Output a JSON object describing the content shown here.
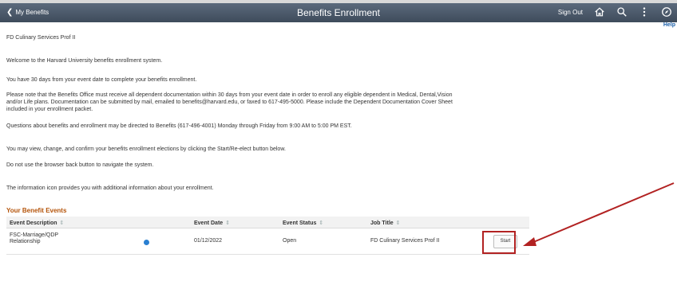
{
  "header": {
    "back_label": "My Benefits",
    "title": "Benefits Enrollment",
    "signout_label": "Sign Out",
    "help_label": "Help"
  },
  "content": {
    "job_label": "FD Culinary Services Prof II",
    "welcome": "Welcome to the Harvard University benefits enrollment system.",
    "deadline": "You have 30 days from your event date to complete your benefits enrollment.",
    "note_line1": "Please note that the Benefits Office must receive all dependent documentation within 30 days from your event date in order to enroll any eligible dependent in Medical, Dental,Vision",
    "note_line2": "and/or Life plans. Documentation can be submitted by mail, emailed to benefits@harvard.edu, or faxed to 617-495-5000. Please include the Dependent Documentation Cover Sheet",
    "note_line3": "included in your enrollment packet.",
    "questions": "Questions about benefits and enrollment may be directed to Benefits (617-496-4001) Monday through Friday from 9:00 AM to 5:00 PM EST.",
    "view_change": "You may view, change, and confirm your benefits enrollment elections by clicking the Start/Re-elect button below.",
    "no_back": "Do not use the browser back button to navigate the system.",
    "info_icon_note": "The information icon provides you with additional information about your enrollment."
  },
  "events": {
    "title": "Your Benefit Events",
    "columns": {
      "description": "Event Description",
      "date": "Event Date",
      "status": "Event Status",
      "job": "Job Title"
    },
    "rows": [
      {
        "description_line1": "FSC-Marriage/QDP",
        "description_line2": "Relationship",
        "date": "01/12/2022",
        "status": "Open",
        "job": "FD Culinary Services Prof II",
        "action": "Start"
      }
    ]
  },
  "colors": {
    "header_bg": "#4b596a",
    "section_title": "#b45309",
    "annotation": "#b22222",
    "info_icon": "#2a7fd1"
  },
  "icons": [
    "chevron-left-icon",
    "home-icon",
    "search-icon",
    "kebab-menu-icon",
    "navbar-icon",
    "info-icon"
  ]
}
